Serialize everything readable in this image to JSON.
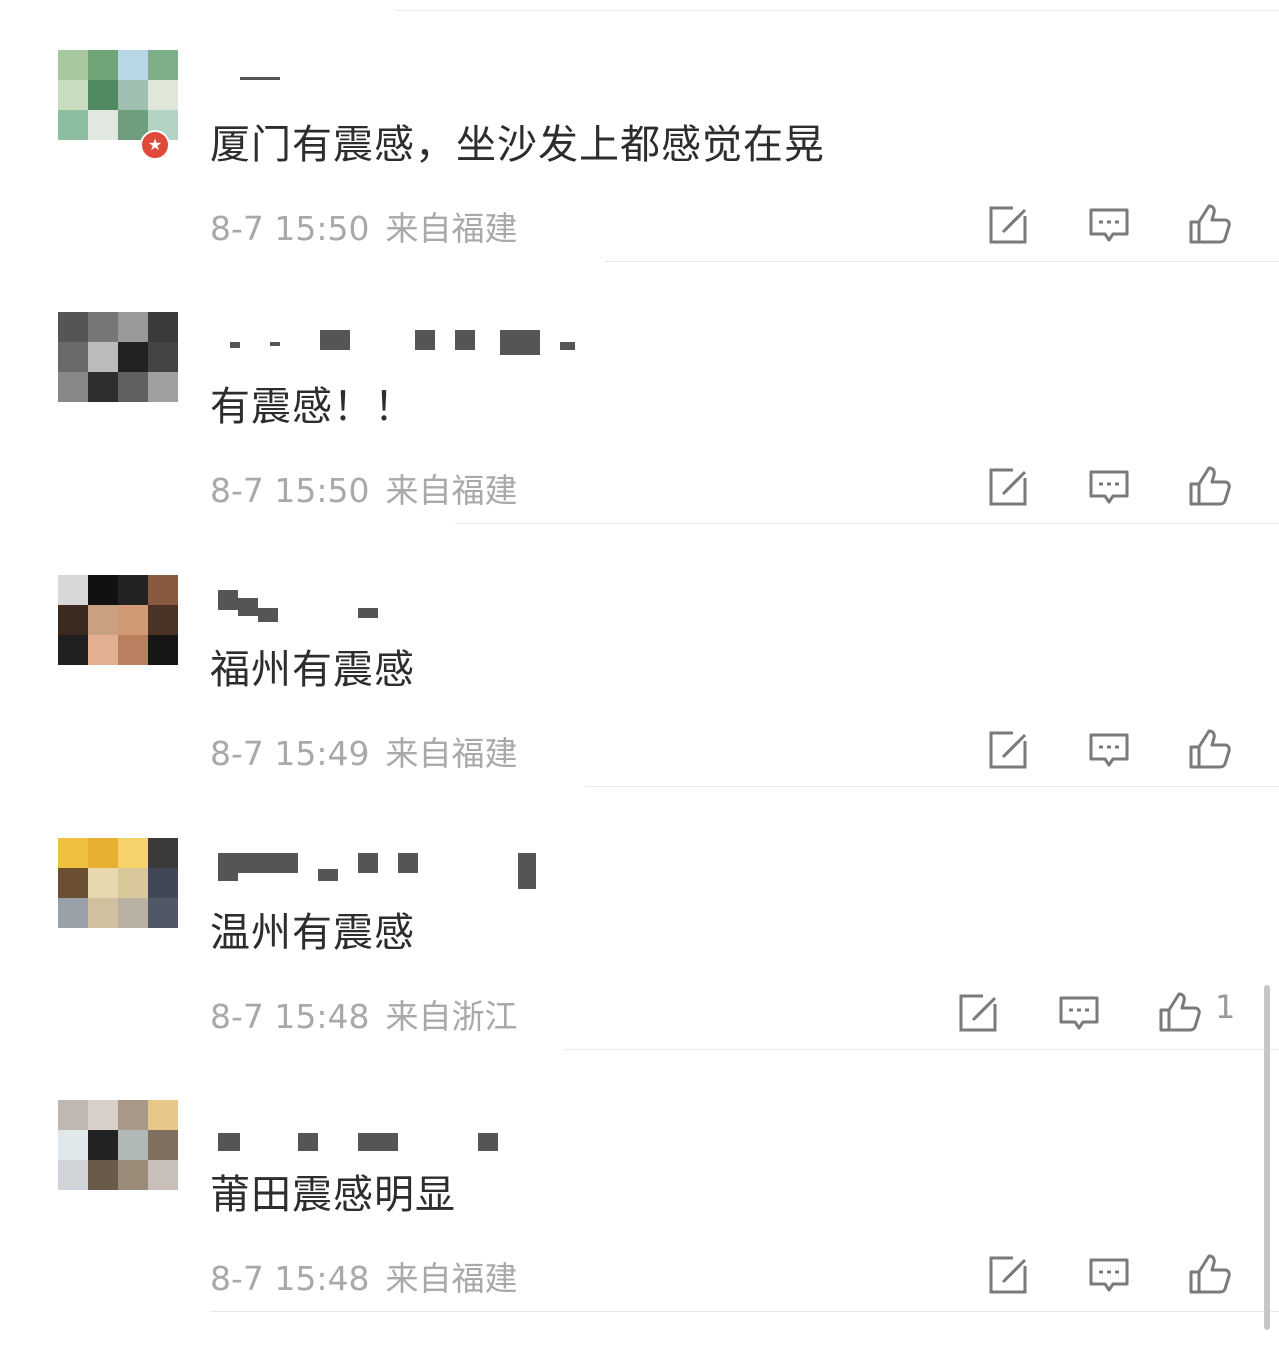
{
  "comments": [
    {
      "text": "厦门有震感，坐沙发上都感觉在晃",
      "time": "8-7 15:50",
      "location": "来自福建",
      "likes": "",
      "avatar_colors": [
        "#a8c9a0",
        "#6fa579",
        "#b8d6e6",
        "#7fae8a",
        "#c8dcc0",
        "#4f8a63",
        "#9fc0b0",
        "#dfe8d8",
        "#8cbfa0",
        "#e0e8e0",
        "#6f9e7f",
        "#b5d3c4"
      ]
    },
    {
      "text": "有震感！！",
      "time": "8-7 15:50",
      "location": "来自福建",
      "likes": "",
      "avatar_colors": [
        "#555555",
        "#777777",
        "#999999",
        "#3a3a3a",
        "#6a6a6a",
        "#bbbbbb",
        "#222222",
        "#444444",
        "#888888",
        "#2e2e2e",
        "#606060",
        "#a0a0a0"
      ]
    },
    {
      "text": "福州有震感",
      "time": "8-7 15:49",
      "location": "来自福建",
      "likes": "",
      "avatar_colors": [
        "#d8d8d8",
        "#111111",
        "#222222",
        "#8a5a40",
        "#3b2a20",
        "#c9a080",
        "#cf9a74",
        "#4a3325",
        "#202020",
        "#e2b090",
        "#b98060",
        "#161616"
      ]
    },
    {
      "text": "温州有震感",
      "time": "8-7 15:48",
      "location": "来自浙江",
      "likes": "1",
      "avatar_colors": [
        "#f0c040",
        "#e8b030",
        "#f5d36a",
        "#3a3a3a",
        "#6a5030",
        "#e8d8b0",
        "#d8c89a",
        "#404858",
        "#9aa0a8",
        "#d0c0a0",
        "#b8b0a0",
        "#505868"
      ]
    },
    {
      "text": "莆田震感明显",
      "time": "8-7 15:48",
      "location": "来自福建",
      "likes": "",
      "avatar_colors": [
        "#c0b8b0",
        "#d8d0c8",
        "#a89888",
        "#e8c888",
        "#e0e8ec",
        "#222222",
        "#b0b8b8",
        "#807060",
        "#d0d4d8",
        "#6a5a4a",
        "#9a8a78",
        "#c8c0b8"
      ]
    }
  ],
  "icons": {
    "share": "share-icon",
    "reply": "comment-icon",
    "like": "thumbs-up-icon"
  },
  "colors": {
    "text": "#2d2d2d",
    "meta": "#a9a9a9",
    "divider": "#e8e8e8",
    "badge": "#e0483a"
  }
}
